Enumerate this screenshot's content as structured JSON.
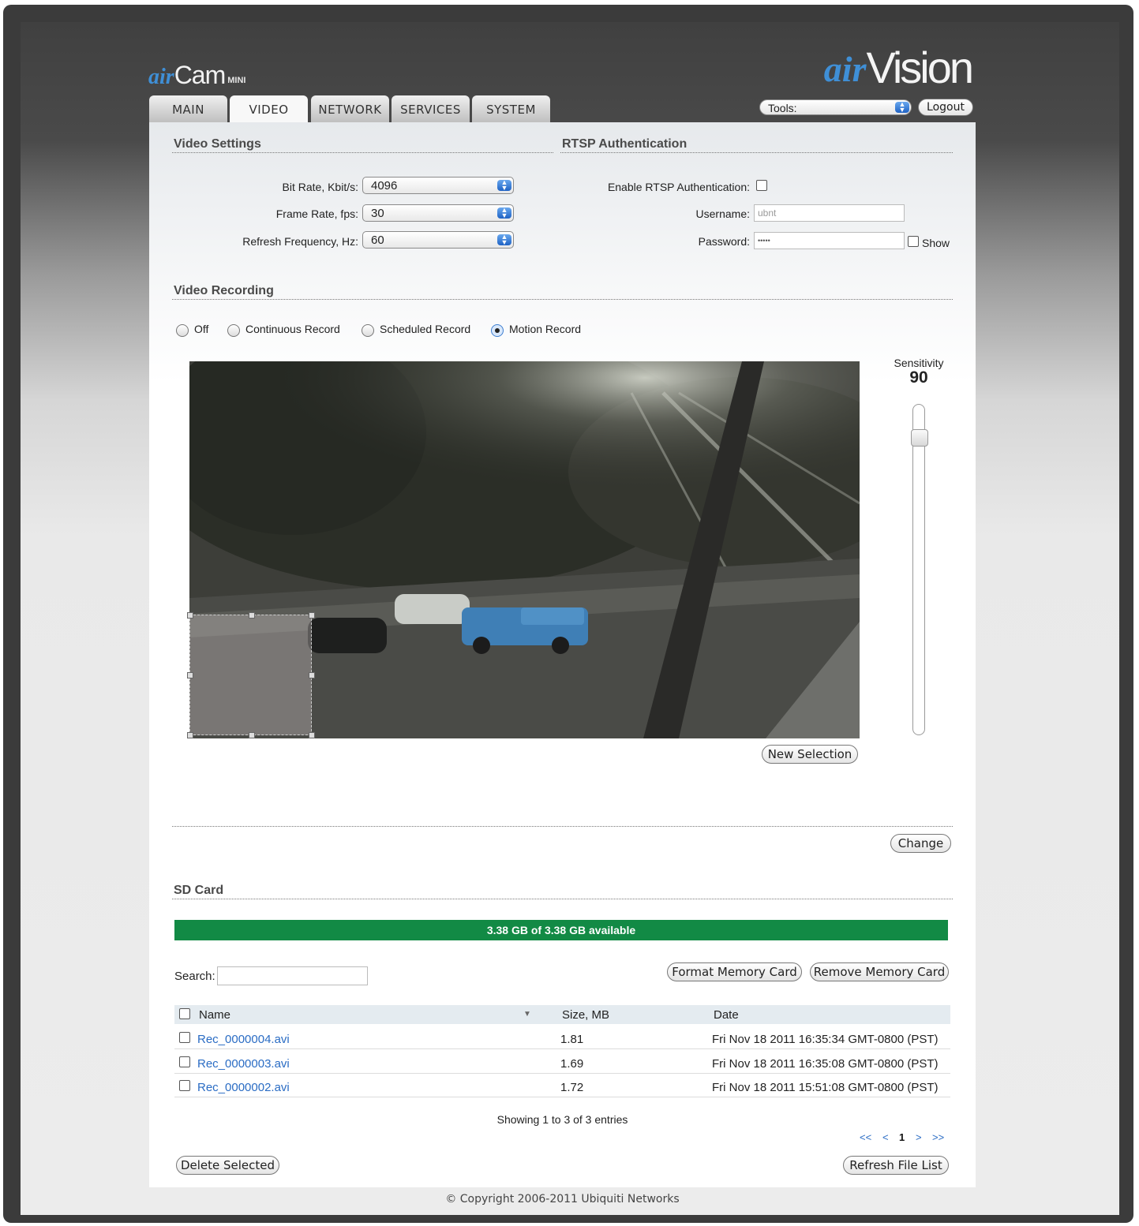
{
  "brand": {
    "product_prefix": "air",
    "product_name": "Cam",
    "product_suffix": "MINI",
    "vendor_prefix": "air",
    "vendor_name": "Vision"
  },
  "tabs": [
    {
      "label": "MAIN",
      "active": false
    },
    {
      "label": "VIDEO",
      "active": true
    },
    {
      "label": "NETWORK",
      "active": false
    },
    {
      "label": "SERVICES",
      "active": false
    },
    {
      "label": "SYSTEM",
      "active": false
    }
  ],
  "header": {
    "tools_value": "Tools:",
    "logout_label": "Logout"
  },
  "video_settings": {
    "title": "Video Settings",
    "bitrate_label": "Bit Rate, Kbit/s:",
    "bitrate_value": "4096",
    "framerate_label": "Frame Rate, fps:",
    "framerate_value": "30",
    "refresh_label": "Refresh Frequency, Hz:",
    "refresh_value": "60"
  },
  "rtsp": {
    "title": "RTSP Authentication",
    "enable_label": "Enable RTSP Authentication:",
    "enabled": false,
    "username_label": "Username:",
    "username_value": "ubnt",
    "password_label": "Password:",
    "password_value": "•••••",
    "show_label": "Show"
  },
  "recording": {
    "title": "Video Recording",
    "options": [
      "Off",
      "Continuous Record",
      "Scheduled Record",
      "Motion Record"
    ],
    "selected": "Motion Record",
    "sensitivity_label": "Sensitivity",
    "sensitivity_value": "90",
    "sensitivity_level": 90,
    "new_selection_label": "New Selection",
    "change_label": "Change"
  },
  "sdcard": {
    "title": "SD Card",
    "available_text": "3.38 GB of 3.38 GB available",
    "available_fraction": 1.0,
    "search_label": "Search:",
    "search_value": "",
    "format_label": "Format Memory Card",
    "remove_label": "Remove Memory Card",
    "columns": [
      "Name",
      "Size, MB",
      "Date"
    ],
    "rows": [
      {
        "name": "Rec_0000004.avi",
        "size": "1.81",
        "date": "Fri Nov 18 2011 16:35:34 GMT-0800 (PST)"
      },
      {
        "name": "Rec_0000003.avi",
        "size": "1.69",
        "date": "Fri Nov 18 2011 16:35:08 GMT-0800 (PST)"
      },
      {
        "name": "Rec_0000002.avi",
        "size": "1.72",
        "date": "Fri Nov 18 2011 15:51:08 GMT-0800 (PST)"
      }
    ],
    "showing_text": "Showing 1 to 3 of 3 entries",
    "pager": {
      "first": "<<",
      "prev": "<",
      "page": "1",
      "next": ">",
      "last": ">>"
    },
    "delete_label": "Delete Selected",
    "refresh_label": "Refresh File List"
  },
  "footer": {
    "copyright": "© Copyright 2006-2011 Ubiquiti Networks"
  },
  "colors": {
    "accent": "#3f8fd6",
    "available_bar": "#128a45",
    "link": "#2a6cc4"
  }
}
